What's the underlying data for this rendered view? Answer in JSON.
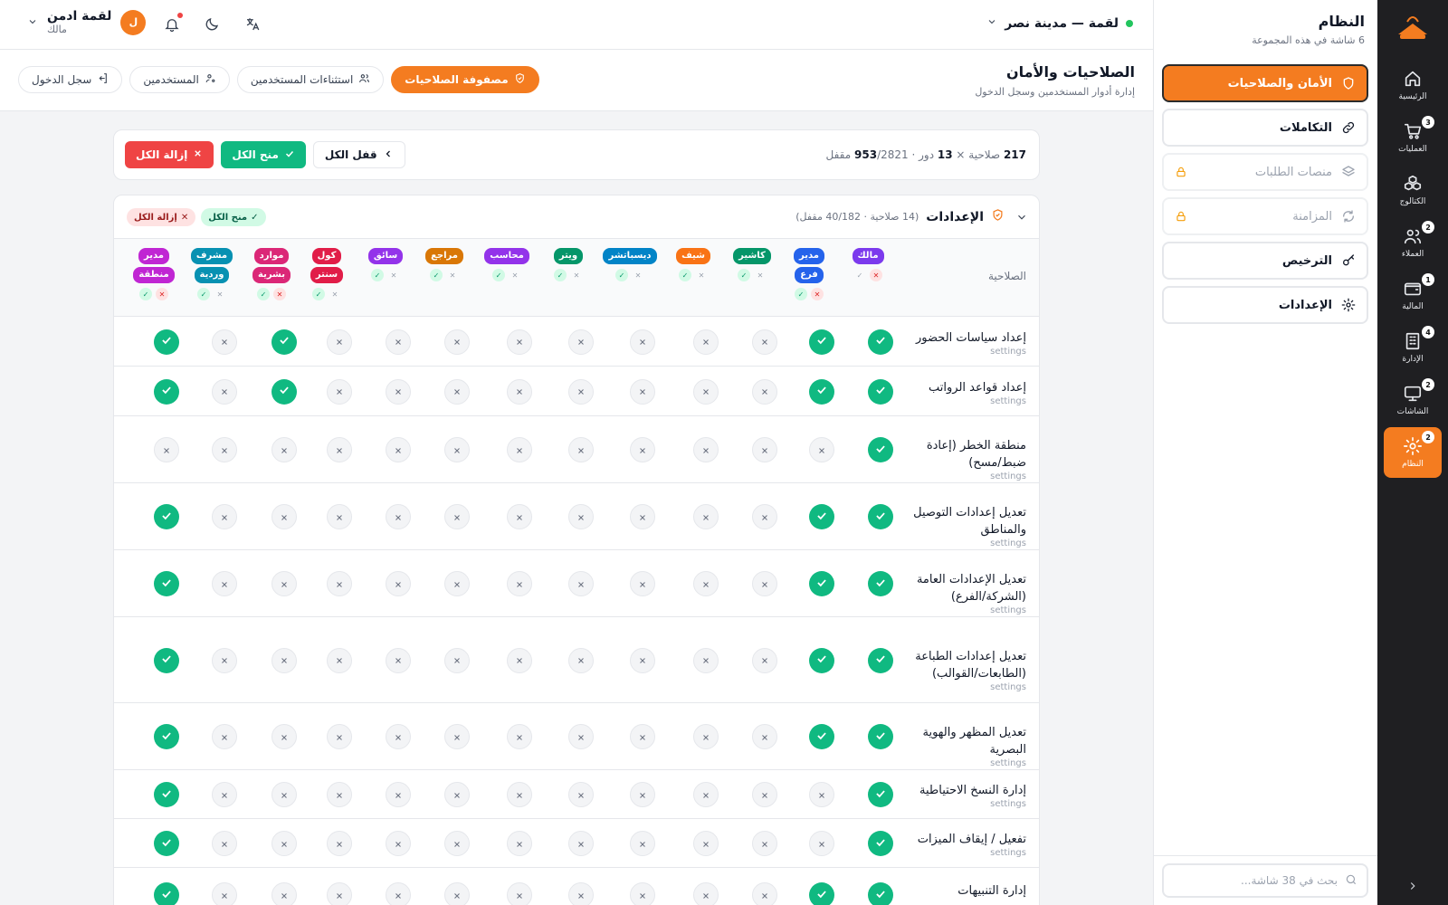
{
  "rail": {
    "items": [
      {
        "label": "الرئيسية",
        "icon": "home-icon",
        "badge": ""
      },
      {
        "label": "العمليات",
        "icon": "cart-icon",
        "badge": "3"
      },
      {
        "label": "الكتالوج",
        "icon": "boxes-icon",
        "badge": ""
      },
      {
        "label": "العملاء",
        "icon": "users-icon",
        "badge": "2"
      },
      {
        "label": "المالية",
        "icon": "wallet-icon",
        "badge": "1"
      },
      {
        "label": "الإدارة",
        "icon": "building-icon",
        "badge": "4"
      },
      {
        "label": "الشاشات",
        "icon": "monitor-icon",
        "badge": "2"
      },
      {
        "label": "النظام",
        "icon": "gear-icon",
        "badge": "2"
      }
    ]
  },
  "system": {
    "title": "النظام",
    "subtitle": "6 شاشة في هذه المجموعة",
    "items": [
      {
        "label": "الأمان والصلاحيات",
        "icon": "shield-icon",
        "state": "active"
      },
      {
        "label": "التكاملات",
        "icon": "link-icon",
        "state": "normal"
      },
      {
        "label": "منصات الطلبات",
        "icon": "layers-icon",
        "state": "locked"
      },
      {
        "label": "المزامنة",
        "icon": "sync-icon",
        "state": "locked"
      },
      {
        "label": "الترخيص",
        "icon": "key-icon",
        "state": "normal"
      },
      {
        "label": "الإعدادات",
        "icon": "gear-icon",
        "state": "normal"
      }
    ],
    "search_placeholder": "بحث في 38 شاشة..."
  },
  "topbar": {
    "branch": "لقمة — مدينة نصر",
    "user_name": "لقمة ادمن",
    "user_role": "مالك",
    "avatar": "ل"
  },
  "page": {
    "title": "الصلاحيات والأمان",
    "subtitle": "إدارة أدوار المستخدمين وسجل الدخول",
    "tabs": [
      "مصفوفة الصلاحيات",
      "استثناءات المستخدمين",
      "المستخدمين",
      "سجل الدخول"
    ]
  },
  "stats": {
    "perms": "217",
    "perms_label": "صلاحية ×",
    "roles": "13",
    "roles_label": "دور ·",
    "locked": "953",
    "total": "/2821",
    "locked_label": "مقفل",
    "lock_all": "قفل الكل",
    "grant_all": "منح الكل",
    "remove_all": "إزالة الكل"
  },
  "section": {
    "title": "الإعدادات",
    "meta": "(14 صلاحية · 40/182 مقفل)",
    "grant_all": "منح الكل",
    "remove_all": "إزالة الكل",
    "col_label": "الصلاحية"
  },
  "roles": [
    {
      "lines": [
        "مالك"
      ],
      "color": "#7c3aed"
    },
    {
      "lines": [
        "مدير",
        "فرع"
      ],
      "color": "#2563eb"
    },
    {
      "lines": [
        "كاشير"
      ],
      "color": "#059669"
    },
    {
      "lines": [
        "شيف"
      ],
      "color": "#f97316"
    },
    {
      "lines": [
        "ديسباتشر"
      ],
      "color": "#0284c7"
    },
    {
      "lines": [
        "ويتر"
      ],
      "color": "#059669"
    },
    {
      "lines": [
        "محاسب"
      ],
      "color": "#9333ea"
    },
    {
      "lines": [
        "مراجع"
      ],
      "color": "#d97706"
    },
    {
      "lines": [
        "سائق"
      ],
      "color": "#9333ea"
    },
    {
      "lines": [
        "كول",
        "سنتر"
      ],
      "color": "#e11d48"
    },
    {
      "lines": [
        "موارد",
        "بشرية"
      ],
      "color": "#db2777"
    },
    {
      "lines": [
        "مشرف",
        "وردية"
      ],
      "color": "#0891b2"
    },
    {
      "lines": [
        "مدير",
        "منطقة"
      ],
      "color": "#c026d3"
    }
  ],
  "rows": [
    {
      "name": "إعداد سياسات الحضور",
      "cat": "settings",
      "grants": [
        1,
        1,
        0,
        0,
        0,
        0,
        0,
        0,
        0,
        0,
        1,
        0,
        1
      ]
    },
    {
      "name": "إعداد قواعد الرواتب",
      "cat": "settings",
      "grants": [
        1,
        1,
        0,
        0,
        0,
        0,
        0,
        0,
        0,
        0,
        1,
        0,
        1
      ]
    },
    {
      "name": "منطقة الخطر (إعادة ضبط/مسح)",
      "cat": "settings",
      "grants": [
        1,
        0,
        0,
        0,
        0,
        0,
        0,
        0,
        0,
        0,
        0,
        0,
        0
      ]
    },
    {
      "name": "تعديل إعدادات التوصيل والمناطق",
      "cat": "settings",
      "grants": [
        1,
        1,
        0,
        0,
        0,
        0,
        0,
        0,
        0,
        0,
        0,
        0,
        1
      ]
    },
    {
      "name": "تعديل الإعدادات العامة (الشركة/الفرع)",
      "cat": "settings",
      "grants": [
        1,
        1,
        0,
        0,
        0,
        0,
        0,
        0,
        0,
        0,
        0,
        0,
        1
      ]
    },
    {
      "name": "تعديل إعدادات الطباعة (الطابعات/القوالب)",
      "cat": "settings",
      "grants": [
        1,
        1,
        0,
        0,
        0,
        0,
        0,
        0,
        0,
        0,
        0,
        0,
        1
      ]
    },
    {
      "name": "تعديل المظهر والهوية البصرية",
      "cat": "settings",
      "grants": [
        1,
        1,
        0,
        0,
        0,
        0,
        0,
        0,
        0,
        0,
        0,
        0,
        1
      ]
    },
    {
      "name": "إدارة النسخ الاحتياطية",
      "cat": "settings",
      "grants": [
        1,
        0,
        0,
        0,
        0,
        0,
        0,
        0,
        0,
        0,
        0,
        0,
        1
      ]
    },
    {
      "name": "تفعيل / إيقاف الميزات",
      "cat": "settings",
      "grants": [
        1,
        0,
        0,
        0,
        0,
        0,
        0,
        0,
        0,
        0,
        0,
        0,
        1
      ]
    },
    {
      "name": "إدارة التنبيهات",
      "cat": "",
      "grants": [
        1,
        1,
        0,
        0,
        0,
        0,
        0,
        0,
        0,
        0,
        0,
        0,
        1
      ]
    }
  ],
  "colors": {
    "accent": "#f47c20",
    "grant": "#10b981",
    "deny": "#ef4444"
  }
}
